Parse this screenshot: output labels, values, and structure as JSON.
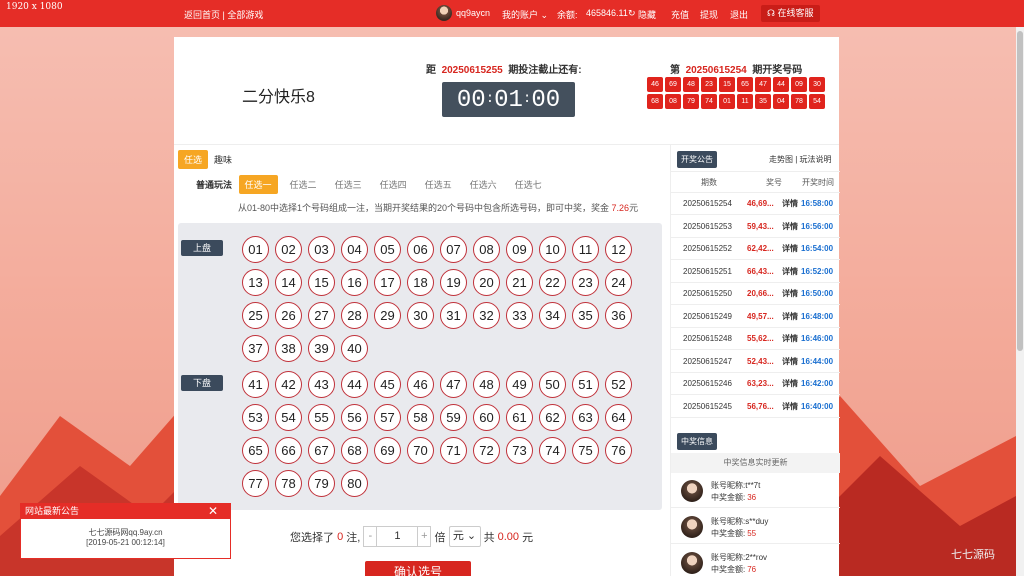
{
  "overlay": {
    "resolution": "1920 x 1080"
  },
  "topbar": {
    "home": "返回首页",
    "sep": " | ",
    "games": "全部游戏",
    "username": "qq9aycn",
    "account": "我的账户",
    "balance_label": "余额:",
    "balance": "465846.11",
    "hide": "隐藏",
    "recharge": "充值",
    "withdraw": "提现",
    "logout": "退出",
    "service": "在线客服"
  },
  "header": {
    "game": "二分快乐8",
    "deadline_prefix": "距",
    "deadline_issue": "20250615255",
    "deadline_suffix": "期投注截止还有:",
    "timer": {
      "h": "00",
      "m": "01",
      "s": "00"
    },
    "draw_prefix": "第",
    "draw_issue": "20250615254",
    "draw_suffix": "期开奖号码",
    "draw_numbers": [
      "46",
      "69",
      "48",
      "23",
      "15",
      "65",
      "47",
      "44",
      "09",
      "30",
      "68",
      "08",
      "79",
      "74",
      "01",
      "11",
      "35",
      "04",
      "78",
      "54"
    ]
  },
  "tabs": {
    "primary": [
      "任选",
      "趣味"
    ],
    "mode_label": "普通玩法",
    "secondary": [
      "任选一",
      "任选二",
      "任选三",
      "任选四",
      "任选五",
      "任选六",
      "任选七"
    ],
    "description": "从01-80中选择1个号码组成一注，当期开奖结果的20个号码中包含所选号码，即可中奖，奖金 ",
    "prize": "7.26",
    "prize_unit": "元"
  },
  "board": {
    "upper_label": "上盘",
    "lower_label": "下盘",
    "upper": [
      "01",
      "02",
      "03",
      "04",
      "05",
      "06",
      "07",
      "08",
      "09",
      "10",
      "11",
      "12",
      "13",
      "14",
      "15",
      "16",
      "17",
      "18",
      "19",
      "20",
      "21",
      "22",
      "23",
      "24",
      "25",
      "26",
      "27",
      "28",
      "29",
      "30",
      "31",
      "32",
      "33",
      "34",
      "35",
      "36",
      "37",
      "38",
      "39",
      "40"
    ],
    "lower": [
      "41",
      "42",
      "43",
      "44",
      "45",
      "46",
      "47",
      "48",
      "49",
      "50",
      "51",
      "52",
      "53",
      "54",
      "55",
      "56",
      "57",
      "58",
      "59",
      "60",
      "61",
      "62",
      "63",
      "64",
      "65",
      "66",
      "67",
      "68",
      "69",
      "70",
      "71",
      "72",
      "73",
      "74",
      "75",
      "76",
      "77",
      "78",
      "79",
      "80"
    ]
  },
  "bet": {
    "chosen_prefix": "您选择了",
    "chosen_count": "0",
    "chosen_suffix": "注,",
    "minus": "-",
    "multiplier": "1",
    "plus": "+",
    "times": "倍",
    "unit": "元",
    "total_prefix": "共",
    "total": "0.00",
    "total_unit": "元",
    "confirm": "确认选号"
  },
  "results": {
    "title": "开奖公告",
    "links": "走势图 | 玩法说明",
    "cols": [
      "期数",
      "奖号",
      "开奖时间"
    ],
    "rows": [
      {
        "issue": "20250615254",
        "nums": "46,69...",
        "detail": "详情",
        "time": "16:58:00"
      },
      {
        "issue": "20250615253",
        "nums": "59,43...",
        "detail": "详情",
        "time": "16:56:00"
      },
      {
        "issue": "20250615252",
        "nums": "62,42...",
        "detail": "详情",
        "time": "16:54:00"
      },
      {
        "issue": "20250615251",
        "nums": "66,43...",
        "detail": "详情",
        "time": "16:52:00"
      },
      {
        "issue": "20250615250",
        "nums": "20,66...",
        "detail": "详情",
        "time": "16:50:00"
      },
      {
        "issue": "20250615249",
        "nums": "49,57...",
        "detail": "详情",
        "time": "16:48:00"
      },
      {
        "issue": "20250615248",
        "nums": "55,62...",
        "detail": "详情",
        "time": "16:46:00"
      },
      {
        "issue": "20250615247",
        "nums": "52,43...",
        "detail": "详情",
        "time": "16:44:00"
      },
      {
        "issue": "20250615246",
        "nums": "63,23...",
        "detail": "详情",
        "time": "16:42:00"
      },
      {
        "issue": "20250615245",
        "nums": "56,76...",
        "detail": "详情",
        "time": "16:40:00"
      }
    ]
  },
  "winners": {
    "title": "中奖信息",
    "subtitle": "中奖信息实时更新",
    "nick_label": "账号昵称:",
    "amount_label": "中奖金额:",
    "list": [
      {
        "nick": "t**7t",
        "amount": "36"
      },
      {
        "nick": "s**duy",
        "amount": "55"
      },
      {
        "nick": "2**rov",
        "amount": "76"
      }
    ]
  },
  "notice": {
    "title": "网站最新公告",
    "close": "✕",
    "text": "七七源码网qq.9ay.cn",
    "date": "[2019-05-21 00:12:14]"
  },
  "watermark": "七七源码",
  "colors": {
    "primary": "#e52d27",
    "accent": "#f6a623",
    "dark": "#3b4a5c",
    "time": "#1a6fd0"
  }
}
